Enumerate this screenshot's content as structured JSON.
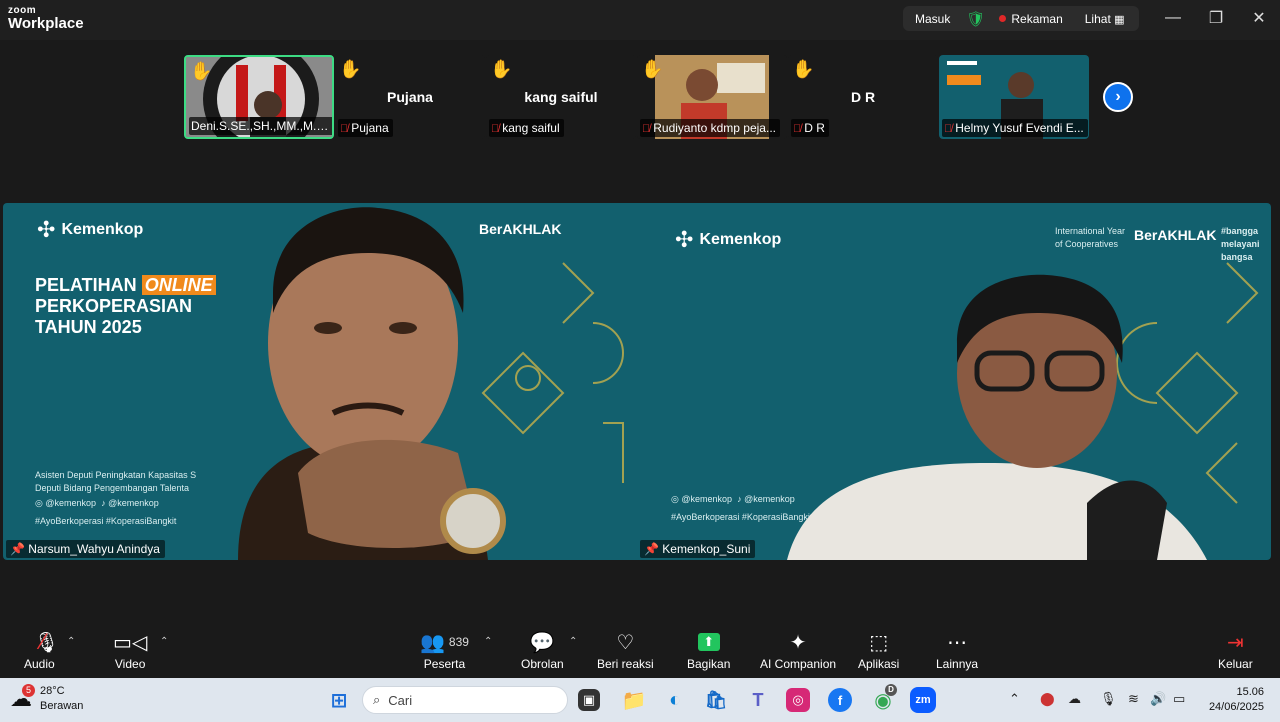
{
  "titlebar": {
    "logo_top": "zoom",
    "logo_bottom": "Workplace",
    "masuk": "Masuk",
    "rekaman": "Rekaman",
    "lihat": "Lihat",
    "minimize": "—",
    "restore": "❐",
    "close": "✕"
  },
  "participants": [
    {
      "label": "Deni.S.SE.,SH.,MM.,M.Ak...",
      "center": ""
    },
    {
      "label": "Pujana",
      "center": "Pujana"
    },
    {
      "label": "kang saiful",
      "center": "kang saiful"
    },
    {
      "label": "Rudiyanto kdmp peja...",
      "center": ""
    },
    {
      "label": "D R",
      "center": "D R"
    },
    {
      "label": "Helmy Yusuf Evendi E...",
      "center": ""
    }
  ],
  "stage": {
    "left_name": "Narsum_Wahyu Anindya",
    "right_name": "Kemenkop_Suni",
    "brand": "Kemenkop",
    "title_line1": "PELATIHAN",
    "title_online": "ONLINE",
    "title_line2": "PERKOPERASIAN",
    "title_line3": "TAHUN 2025",
    "berakhlak": "BerAKHLAK",
    "bangga": "#bangga melayani bangsa",
    "asisten1": "Asisten Deputi Peningkatan Kapasitas S",
    "asisten2": "Deputi Bidang Pengembangan Talenta",
    "social1": "@kemenkop",
    "social2": "@kemenkop",
    "hashtags": "#AyoBerkoperasi #KoperasiBangkit",
    "intl_year": "International Year of Cooperatives"
  },
  "toolbar": {
    "audio": "Audio",
    "video": "Video",
    "peserta": "Peserta",
    "peserta_count": "839",
    "obrolan": "Obrolan",
    "beri_reaksi": "Beri reaksi",
    "bagikan": "Bagikan",
    "ai": "AI Companion",
    "aplikasi": "Aplikasi",
    "lainnya": "Lainnya",
    "keluar": "Keluar"
  },
  "taskbar": {
    "temp": "28°C",
    "weather": "Berawan",
    "weather_badge": "5",
    "search": "Cari",
    "chrome_badge": "D",
    "time": "15.06",
    "date": "24/06/2025"
  },
  "colors": {
    "video_bg": "#12606e",
    "accent_orange": "#f08a1c",
    "active_border": "#3ddc84",
    "zoom_blue": "#0e72ed"
  }
}
